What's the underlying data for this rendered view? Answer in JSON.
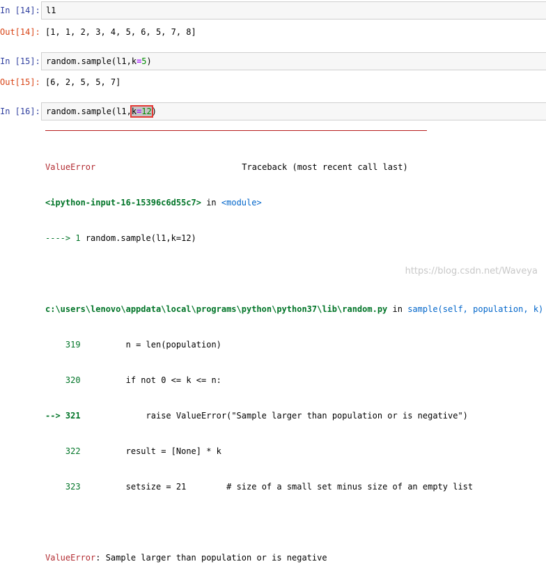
{
  "cells": [
    {
      "in_prompt": "In [14]:",
      "code": "l1",
      "out_prompt": "Out[14]:",
      "output": "[1, 1, 2, 3, 4, 5, 6, 5, 7, 8]"
    },
    {
      "in_prompt": "In [15]:",
      "code_fn": "random.sample(l1,",
      "code_kw": "k",
      "code_eq": "=",
      "code_num": "5",
      "code_close": ")",
      "out_prompt": "Out[15]:",
      "output": "[6, 2, 5, 5, 7]"
    },
    {
      "in_prompt": "In [16]:",
      "code_fn": "random.sample(l1,",
      "code_kw": "k",
      "code_eq": "=",
      "code_num": "12",
      "code_close": ")"
    }
  ],
  "traceback": {
    "error_name": "ValueError",
    "header_right": "Traceback (most recent call last)",
    "frame1_loc": "<ipython-input-16-15396c6d55c7>",
    "frame1_in": "in",
    "frame1_module": "<module>",
    "frame1_arrow": "---->",
    "frame1_lineno": "1",
    "frame1_code": "random.sample(l1,k=12)",
    "frame2_path": "c:\\users\\lenovo\\appdata\\local\\programs\\python\\python37\\lib\\random.py",
    "frame2_in": "in",
    "frame2_fn": "sample(self, population, k)",
    "lines": [
      {
        "prefix": "    ",
        "lineno": "319",
        "code": "n = len(population)"
      },
      {
        "prefix": "    ",
        "lineno": "320",
        "code": "if not 0 <= k <= n:"
      },
      {
        "prefix": "--> ",
        "lineno": "321",
        "code": "raise ValueError(\"Sample larger than population or is negative\")"
      },
      {
        "prefix": "    ",
        "lineno": "322",
        "code": "result = [None] * k"
      },
      {
        "prefix": "    ",
        "lineno": "323",
        "code": "setsize = 21        # size of a small set minus size of an empty list"
      }
    ],
    "final_error": "ValueError",
    "final_message": ": Sample larger than population or is negative"
  },
  "watermark": "https://blog.csdn.net/Waveya"
}
